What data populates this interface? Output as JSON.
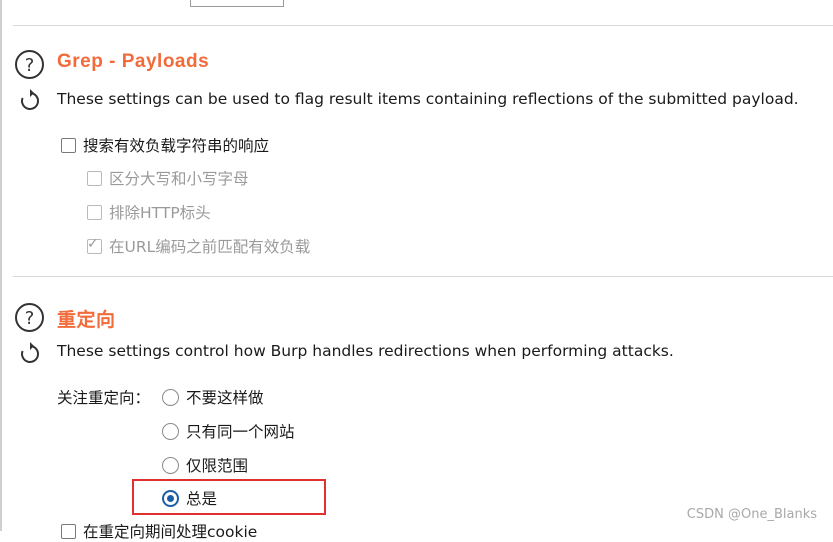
{
  "sections": {
    "grep": {
      "heading": "Grep - Payloads",
      "description": "These settings can be used to flag result items containing reflections of the submitted payload.",
      "options": [
        {
          "label": "搜索有效负载字符串的响应",
          "checked": false,
          "enabled": true
        },
        {
          "label": "区分大写和小写字母",
          "checked": false,
          "enabled": false
        },
        {
          "label": "排除HTTP标头",
          "checked": false,
          "enabled": false
        },
        {
          "label": "在URL编码之前匹配有效负载",
          "checked": true,
          "enabled": false
        }
      ]
    },
    "redirect": {
      "heading": "重定向",
      "description": "These settings control how Burp handles redirections when performing attacks.",
      "follow_label": "关注重定向：",
      "radios": [
        {
          "label": "不要这样做",
          "selected": false
        },
        {
          "label": "只有同一个网站",
          "selected": false
        },
        {
          "label": "仅限范围",
          "selected": false
        },
        {
          "label": "总是",
          "selected": true
        }
      ],
      "cookie_label": "在重定向期间处理cookie"
    }
  },
  "watermark": "CSDN @One_Blanks",
  "icons": {
    "help": "help-icon",
    "restore": "restore-icon"
  },
  "colors": {
    "heading": "#f26b3a",
    "radio_selected": "#1b5fa6",
    "highlight": "#e03030"
  }
}
